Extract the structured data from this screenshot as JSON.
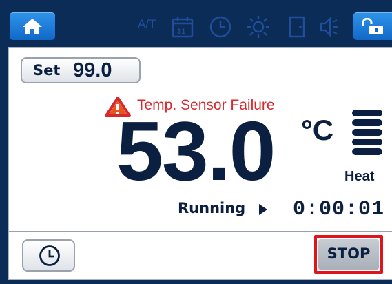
{
  "status_bar": {
    "icons": [
      "home-icon",
      "auto-tune-icon",
      "calendar-icon",
      "clock-icon",
      "light-icon",
      "door-icon",
      "speaker-muted-icon",
      "lock-open-icon"
    ],
    "calendar_day": "31",
    "auto_tune_label": "A/T"
  },
  "setpoint": {
    "label": "Set",
    "value": "99.0"
  },
  "alarm": {
    "text": "Temp. Sensor Failure",
    "icon": "warning-icon",
    "color": "#d7282d"
  },
  "temperature": {
    "value": "53.0",
    "unit": "°C"
  },
  "heat_indicator": {
    "label": "Heat",
    "level": 5
  },
  "run": {
    "state": "Running",
    "elapsed": "0:00:01"
  },
  "actions": {
    "timer_icon": "clock-icon",
    "stop_label": "STOP",
    "highlight_color": "#e0141a"
  },
  "colors": {
    "background": "#0b2c56",
    "accent_blue": "#1f7fdb",
    "dim_icon": "#1f4f9a",
    "text": "#0b1f40"
  }
}
